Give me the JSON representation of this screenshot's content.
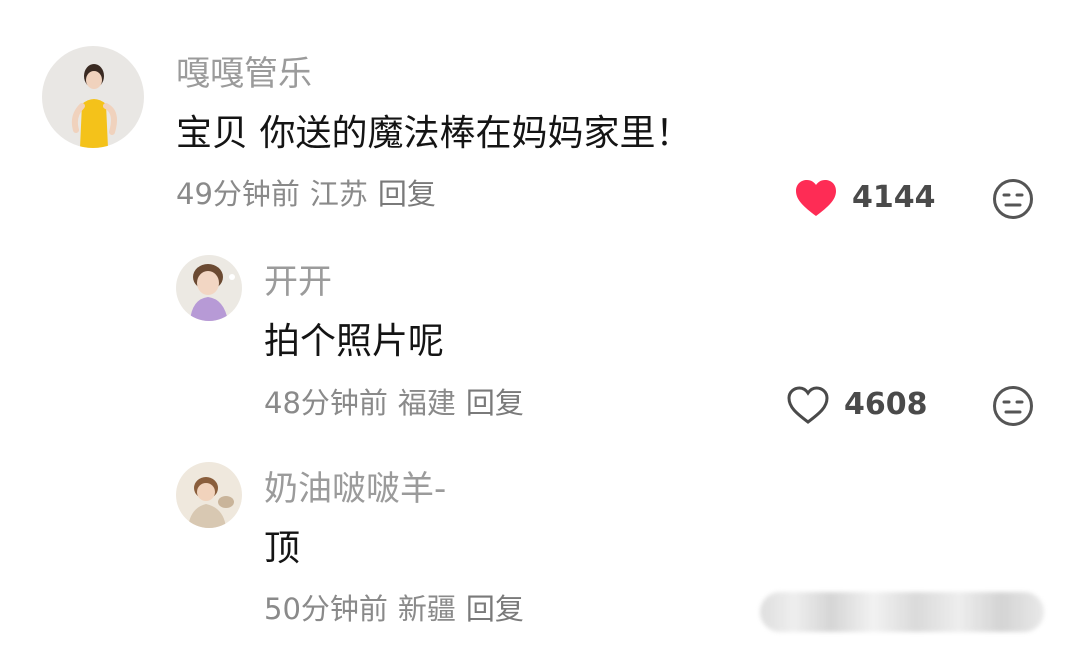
{
  "comments": [
    {
      "username": "嘎嘎管乐",
      "text": "宝贝 你送的魔法棒在妈妈家里！",
      "time": "49分钟前",
      "location": "江苏",
      "reply": "回复",
      "likes": "4144",
      "liked": true
    },
    {
      "username": "开开",
      "text": "拍个照片呢",
      "time": "48分钟前",
      "location": "福建",
      "reply": "回复",
      "likes": "4608",
      "liked": false
    },
    {
      "username": "奶油啵啵羊-",
      "text": "顶",
      "time": "50分钟前",
      "location": "新疆",
      "reply": "回复"
    }
  ],
  "colors": {
    "like_active": "#fe2c55",
    "like_inactive": "#4a4a4a",
    "username": "#9b9b9b",
    "text": "#141414",
    "meta": "#8a8a8a"
  }
}
